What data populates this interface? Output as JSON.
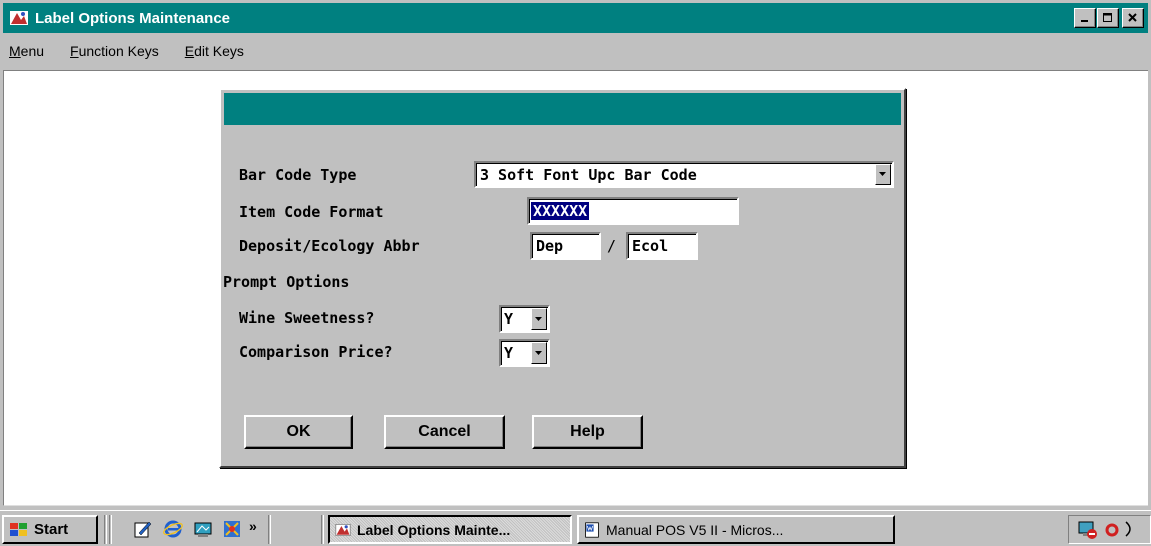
{
  "window": {
    "title": "Label Options Maintenance",
    "title_bar_color": "#008080"
  },
  "menu": {
    "items": [
      {
        "label": "Menu",
        "accel": "M"
      },
      {
        "label": "Function Keys",
        "accel": "F"
      },
      {
        "label": "Edit Keys",
        "accel": "E"
      }
    ]
  },
  "dialog": {
    "bar_code_type": {
      "label": "Bar Code Type",
      "value": "3 Soft Font Upc Bar Code"
    },
    "item_code_format": {
      "label": "Item Code Format",
      "value": "XXXXXX"
    },
    "deposit_ecology": {
      "label": "Deposit/Ecology Abbr",
      "deposit_value": "Dep",
      "separator": "/",
      "ecology_value": "Ecol"
    },
    "prompt_options_heading": "Prompt Options",
    "wine_sweetness": {
      "label": "Wine Sweetness?",
      "value": "Y"
    },
    "comparison_price": {
      "label": "Comparison Price?",
      "value": "Y"
    },
    "buttons": {
      "ok": "OK",
      "cancel": "Cancel",
      "help": "Help"
    }
  },
  "taskbar": {
    "start_label": "Start",
    "quick_launch_icons": [
      "pen-icon",
      "ie-icon",
      "desktop-icon",
      "app-icon"
    ],
    "chevron": "»",
    "tasks": [
      {
        "label": "Label Options Mainte...",
        "active": true
      },
      {
        "label": "Manual POS V5 II - Micros...",
        "active": false
      }
    ]
  }
}
